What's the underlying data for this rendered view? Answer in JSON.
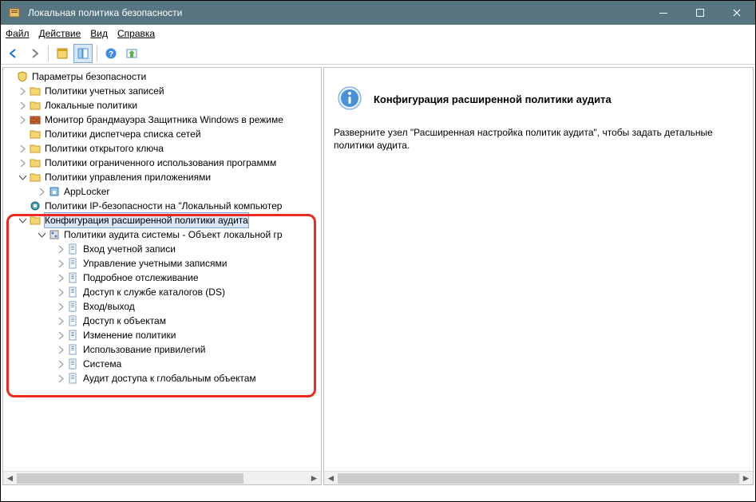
{
  "window": {
    "title": "Локальная политика безопасности"
  },
  "menu": {
    "file": "Файл",
    "action": "Действие",
    "view": "Вид",
    "help": "Справка"
  },
  "tree": {
    "root": "Параметры безопасности",
    "account_policies": "Политики учетных записей",
    "local_policies": "Локальные политики",
    "firewall": "Монитор брандмауэра Защитника Windows в режиме",
    "netlist": "Политики диспетчера списка сетей",
    "publickey": "Политики открытого ключа",
    "softrestrict": "Политики ограниченного использования программм",
    "appctrl": "Политики управления приложениями",
    "applocker": "AppLocker",
    "ipsec": "Политики IP-безопасности на \"Локальный компьютер",
    "advaudit": "Конфигурация расширенной политики аудита",
    "sysaudit": "Политики аудита системы - Объект локальной гр",
    "sub": {
      "a": "Вход учетной записи",
      "b": "Управление учетными записями",
      "c": "Подробное отслеживание",
      "d": "Доступ к службе каталогов (DS)",
      "e": "Вход/выход",
      "f": "Доступ к объектам",
      "g": "Изменение политики",
      "h": "Использование привилегий",
      "i": "Система",
      "j": "Аудит доступа к глобальным объектам"
    }
  },
  "details": {
    "title": "Конфигурация расширенной политики аудита",
    "body": "Разверните узел \"Расширенная настройка политик аудита\", чтобы задать детальные политики аудита."
  }
}
